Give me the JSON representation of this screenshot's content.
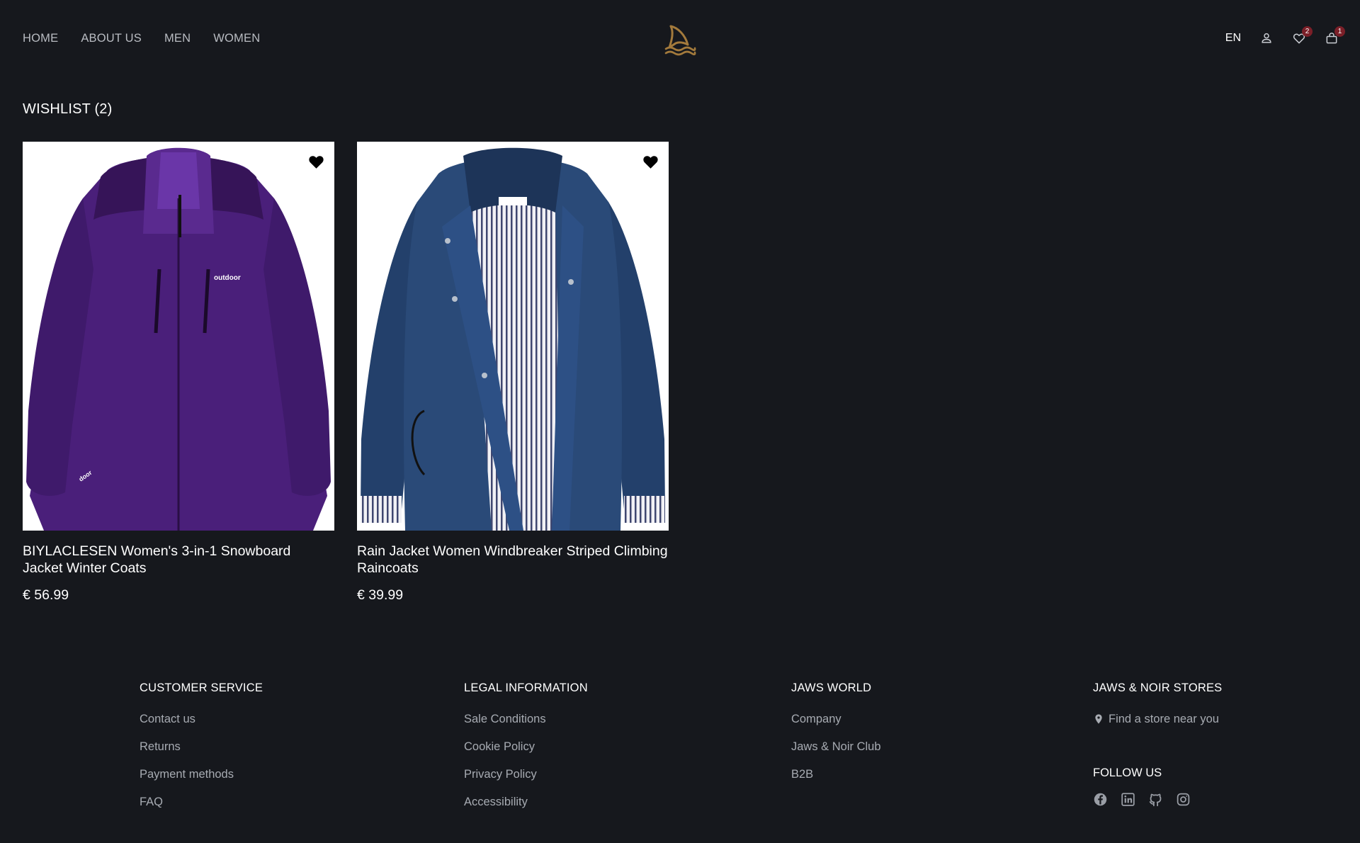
{
  "header": {
    "nav": [
      "HOME",
      "ABOUT US",
      "MEN",
      "WOMEN"
    ],
    "logo_icon": "shark-fin-waves-icon",
    "language": "EN",
    "wishlist_count": "2",
    "cart_count": "1",
    "colors": {
      "logo": "#a37a3c",
      "badge": "#7b1f28",
      "background": "#16181d"
    }
  },
  "wishlist": {
    "title": "WISHLIST (2)",
    "items": [
      {
        "name": "BIYLACLESEN Women's 3-in-1 Snowboard Jacket Winter Coats",
        "price": "€ 56.99",
        "image": "purple-jacket-image",
        "jacket_label": "outdoor",
        "sleeve_label": "door"
      },
      {
        "name": "Rain Jacket Women Windbreaker Striped Climbing Raincoats",
        "price": "€ 39.99",
        "image": "navy-striped-raincoat-image"
      }
    ]
  },
  "footer": {
    "customer_service": {
      "title": "CUSTOMER SERVICE",
      "links": [
        "Contact us",
        "Returns",
        "Payment methods",
        "FAQ"
      ]
    },
    "legal": {
      "title": "LEGAL INFORMATION",
      "links": [
        "Sale Conditions",
        "Cookie Policy",
        "Privacy Policy",
        "Accessibility"
      ]
    },
    "jaws_world": {
      "title": "JAWS WORLD",
      "links": [
        "Company",
        "Jaws & Noir Club",
        "B2B"
      ]
    },
    "stores": {
      "title": "JAWS & NOIR STORES",
      "find_store": "Find a store near you"
    },
    "follow": {
      "title": "FOLLOW US",
      "icons": [
        "facebook-icon",
        "linkedin-icon",
        "github-icon",
        "instagram-icon"
      ]
    }
  }
}
